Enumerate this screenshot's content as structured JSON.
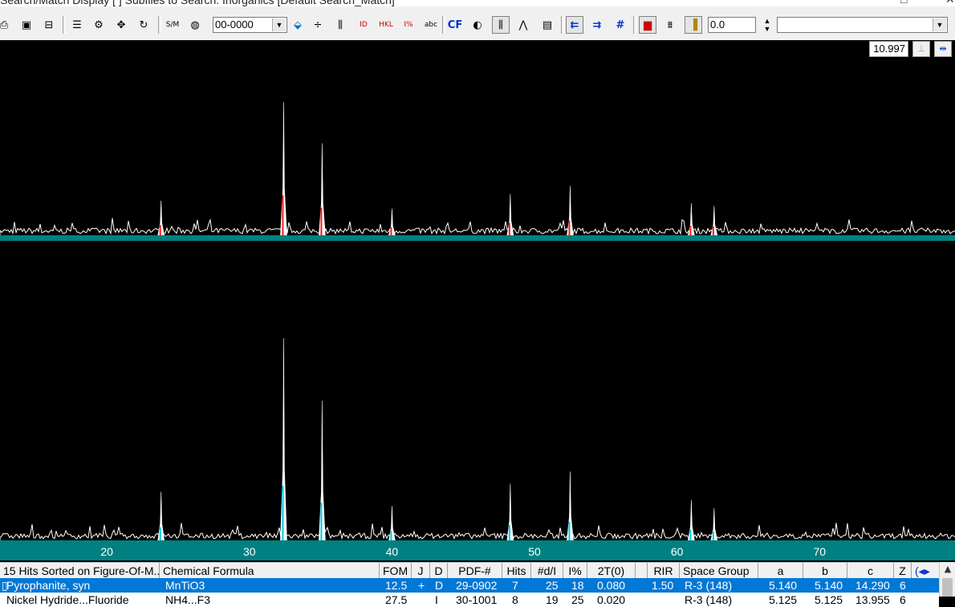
{
  "window": {
    "title": "Search/Match Display [ ] Subfiles to Search: Inorganics [Default Search_Match]"
  },
  "toolbar": {
    "pdf_number_value": "00-0000",
    "offset_value": "0.0",
    "filter_value": "",
    "icons": [
      "print-icon",
      "save-icon",
      "printer-icon",
      "list-icon",
      "settings-icon",
      "move-icon",
      "rotate-icon",
      "sm-icon",
      "globe-icon",
      "pdf-dropdown",
      "gem-icon",
      "split-icon",
      "stick-pattern-icon",
      "id-stick-icon",
      "hkl-icon",
      "intensity-icon",
      "abc-icon",
      "cf-icon",
      "contrast-icon",
      "peak-icon",
      "profile-icon",
      "window-icon",
      "shift-left-icon",
      "shift-right-icon",
      "hash-icon",
      "color-icon",
      "overlay-icon",
      "highlight-icon"
    ]
  },
  "plot": {
    "zoom_value": "10.997",
    "colors": {
      "background": "#000000",
      "pattern": "#ffffff",
      "baseline": "#008080",
      "marker_top": "#ff1a1a",
      "marker_bottom": "#00c8e0"
    },
    "x_ticks": [
      "20",
      "30",
      "40",
      "50",
      "60",
      "70"
    ]
  },
  "chart_data": {
    "type": "line",
    "x_range": [
      12.5,
      79.5
    ],
    "x_ticks": [
      20,
      30,
      40,
      50,
      60,
      70
    ],
    "peaks": [
      {
        "two_theta": 23.8,
        "top": 0.26,
        "bottom": 0.24
      },
      {
        "two_theta": 32.4,
        "top": 1.0,
        "bottom": 1.0
      },
      {
        "two_theta": 35.1,
        "top": 0.69,
        "bottom": 0.69
      },
      {
        "two_theta": 40.0,
        "top": 0.2,
        "bottom": 0.17
      },
      {
        "two_theta": 48.3,
        "top": 0.31,
        "bottom": 0.28
      },
      {
        "two_theta": 52.5,
        "top": 0.37,
        "bottom": 0.34
      },
      {
        "two_theta": 61.0,
        "top": 0.24,
        "bottom": 0.2
      },
      {
        "two_theta": 62.6,
        "top": 0.22,
        "bottom": 0.16
      }
    ],
    "reference_sticks": [
      23.8,
      32.4,
      35.1,
      40.0,
      48.3,
      52.5,
      61.0,
      62.6
    ]
  },
  "results": {
    "columns": {
      "summary": "15 Hits Sorted on Figure-Of-M...",
      "formula": "Chemical Formula",
      "fom": "FOM",
      "j": "J",
      "d": "D",
      "pdf": "PDF-#",
      "hits": "Hits",
      "ndi": "#d/I",
      "ipct": "I%",
      "tt0": "2T(0)",
      "rir": "RIR",
      "sg": "Space Group",
      "a": "a",
      "b": "b",
      "c": "c",
      "z": "Z"
    },
    "rows": [
      {
        "name": "Pyrophanite, syn",
        "formula": "MnTiO3",
        "fom": "12.5",
        "j": "+",
        "d": "D",
        "pdf": "29-0902",
        "hits": "7",
        "ndi": "25",
        "ipct": "18",
        "tt0": "0.080",
        "rir": "1.50",
        "sg": "R-3 (148)",
        "a": "5.140",
        "b": "5.140",
        "c": "14.290",
        "z": "6"
      },
      {
        "name": "Nickel Hydride...Fluoride",
        "formula": "NH4...F3",
        "fom": "27.5",
        "j": "",
        "d": "I",
        "pdf": "30-1001",
        "hits": "8",
        "ndi": "19",
        "ipct": "25",
        "tt0": "0.020",
        "rir": "",
        "sg": "R-3 (148)",
        "a": "5.125",
        "b": "5.125",
        "c": "13.955",
        "z": "6"
      }
    ]
  }
}
